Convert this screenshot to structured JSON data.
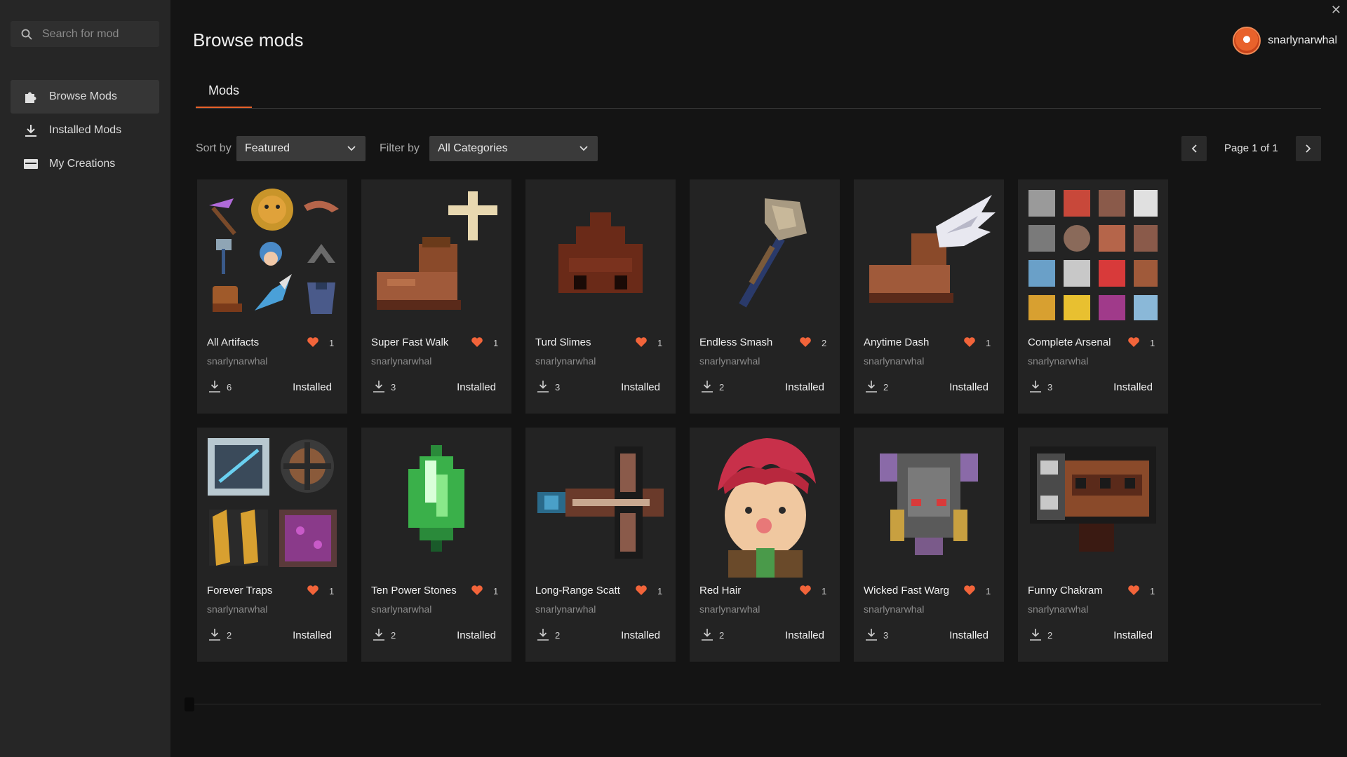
{
  "search": {
    "placeholder": "Search for mod"
  },
  "sidebar": {
    "items": [
      {
        "label": "Browse Mods",
        "icon": "puzzle-piece-icon",
        "active": true
      },
      {
        "label": "Installed Mods",
        "icon": "download-icon",
        "active": false
      },
      {
        "label": "My Creations",
        "icon": "inbox-tray-icon",
        "active": false
      }
    ]
  },
  "header": {
    "title": "Browse mods",
    "username": "snarlynarwhal"
  },
  "tabs": [
    {
      "label": "Mods",
      "active": true
    }
  ],
  "toolbar": {
    "sort_label": "Sort by",
    "sort_value": "Featured",
    "filter_label": "Filter by",
    "filter_value": "All Categories",
    "page_text": "Page 1 of 1"
  },
  "colors": {
    "accent": "#e8622b",
    "heart": "#f2643a",
    "background": "#141414",
    "sidebar": "#262626",
    "card": "#232323"
  },
  "mods": [
    {
      "title": "All Artifacts",
      "author": "snarlynarwhal",
      "likes": "1",
      "downloads": "6",
      "status": "Installed",
      "thumb": "artifacts-collage"
    },
    {
      "title": "Super Fast Walk",
      "author": "snarlynarwhal",
      "likes": "1",
      "downloads": "3",
      "status": "Installed",
      "thumb": "boot-plus"
    },
    {
      "title": "Turd Slimes",
      "author": "snarlynarwhal",
      "likes": "1",
      "downloads": "3",
      "status": "Installed",
      "thumb": "brown-slime"
    },
    {
      "title": "Endless Smash",
      "author": "snarlynarwhal",
      "likes": "2",
      "downloads": "2",
      "status": "Installed",
      "thumb": "hammer"
    },
    {
      "title": "Anytime Dash",
      "author": "snarlynarwhal",
      "likes": "1",
      "downloads": "2",
      "status": "Installed",
      "thumb": "winged-boot"
    },
    {
      "title": "Complete Arsenal",
      "author": "snarlynarwhal",
      "likes": "1",
      "downloads": "3",
      "status": "Installed",
      "thumb": "arsenal-grid"
    },
    {
      "title": "Forever Traps",
      "author": "snarlynarwhal",
      "likes": "1",
      "downloads": "2",
      "status": "Installed",
      "thumb": "traps-collage"
    },
    {
      "title": "Ten Power Stones",
      "author": "snarlynarwhal",
      "likes": "1",
      "downloads": "2",
      "status": "Installed",
      "thumb": "green-crystal"
    },
    {
      "title": "Long-Range Scatt",
      "author": "snarlynarwhal",
      "likes": "1",
      "downloads": "2",
      "status": "Installed",
      "thumb": "crossbow"
    },
    {
      "title": "Red Hair",
      "author": "snarlynarwhal",
      "likes": "1",
      "downloads": "2",
      "status": "Installed",
      "thumb": "red-hair-character"
    },
    {
      "title": "Wicked Fast Warg",
      "author": "snarlynarwhal",
      "likes": "1",
      "downloads": "3",
      "status": "Installed",
      "thumb": "warg-mask"
    },
    {
      "title": "Funny Chakram",
      "author": "snarlynarwhal",
      "likes": "1",
      "downloads": "2",
      "status": "Installed",
      "thumb": "chakram-block"
    }
  ]
}
